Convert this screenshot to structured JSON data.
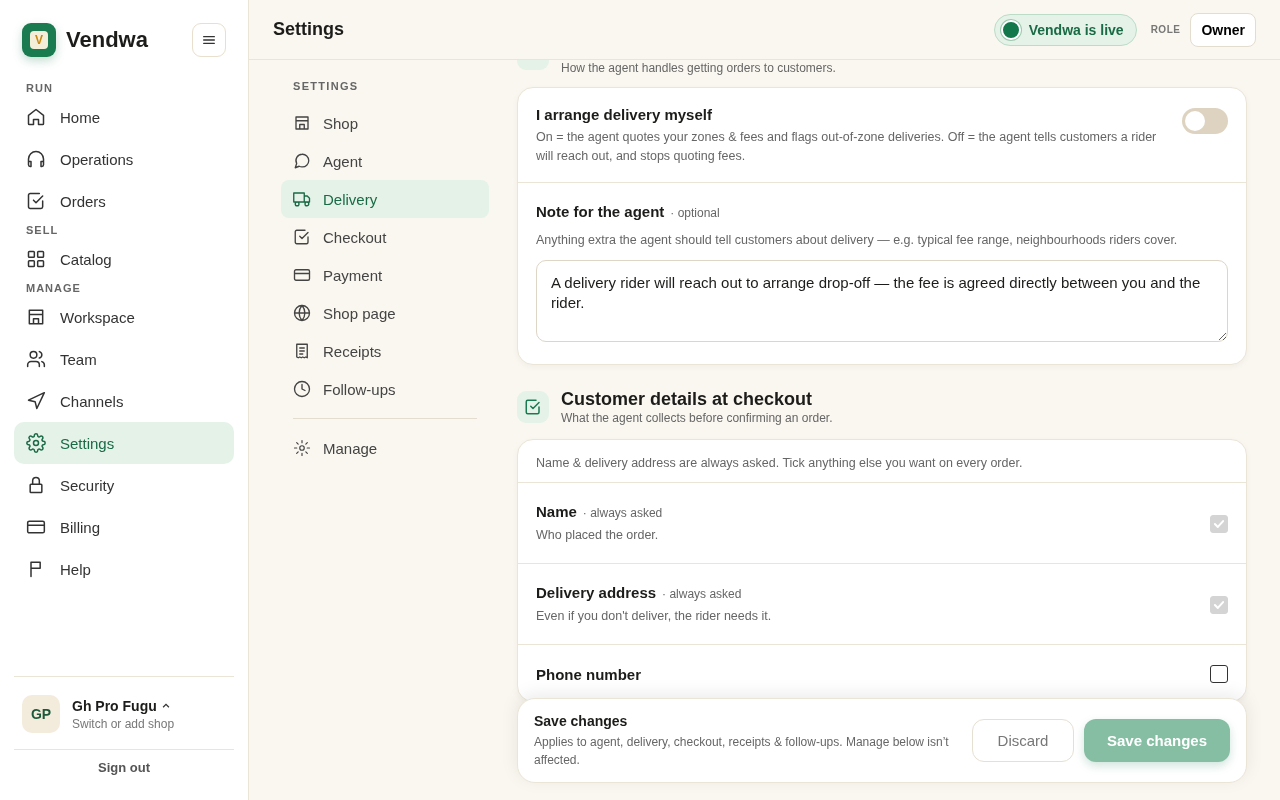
{
  "brand": {
    "name": "Vendwa",
    "mark": "V"
  },
  "nav": [
    {
      "heading": "RUN",
      "items": [
        {
          "label": "Home",
          "selected": false
        },
        {
          "label": "Operations",
          "selected": false
        },
        {
          "label": "Orders",
          "selected": false
        }
      ]
    },
    {
      "heading": "SELL",
      "items": [
        {
          "label": "Catalog",
          "selected": false
        }
      ]
    },
    {
      "heading": "MANAGE",
      "items": [
        {
          "label": "Workspace",
          "selected": false
        },
        {
          "label": "Team",
          "selected": false
        },
        {
          "label": "Channels",
          "selected": false
        },
        {
          "label": "Settings",
          "selected": true
        },
        {
          "label": "Security",
          "selected": false
        },
        {
          "label": "Billing",
          "selected": false
        },
        {
          "label": "Help",
          "selected": false
        }
      ]
    }
  ],
  "shop": {
    "initials": "GP",
    "name": "Gh Pro Fugu",
    "caption": "Switch or add shop"
  },
  "sign_out": "Sign out",
  "header": {
    "title": "Settings",
    "live": {
      "label": "Vendwa is live",
      "on": true
    },
    "role_label": "ROLE",
    "role": "Owner"
  },
  "settings_nav": {
    "heading": "SETTINGS",
    "items": [
      {
        "label": "Shop",
        "selected": false
      },
      {
        "label": "Agent",
        "selected": false
      },
      {
        "label": "Delivery",
        "selected": true
      },
      {
        "label": "Checkout",
        "selected": false
      },
      {
        "label": "Payment",
        "selected": false
      },
      {
        "label": "Shop page",
        "selected": false
      },
      {
        "label": "Receipts",
        "selected": false
      },
      {
        "label": "Follow-ups",
        "selected": false
      }
    ],
    "manage": "Manage"
  },
  "delivery": {
    "subtitle": "How the agent handles getting orders to customers.",
    "toggle": {
      "label": "I arrange delivery myself",
      "description": "On = the agent quotes your zones & fees and flags out-of-zone deliveries. Off = the agent tells customers a rider will reach out, and stops quoting fees.",
      "on": false
    },
    "note": {
      "label": "Note for the agent",
      "tag": "· optional",
      "description": "Anything extra the agent should tell customers about delivery — e.g. typical fee range, neighbourhoods riders cover.",
      "value": "A delivery rider will reach out to arrange drop-off — the fee is agreed directly between you and the rider."
    }
  },
  "checkout": {
    "title": "Customer details at checkout",
    "subtitle": "What the agent collects before confirming an order.",
    "intro": "Name & delivery address are always asked. Tick anything else you want on every order.",
    "fields": [
      {
        "label": "Name",
        "tag": "· always asked",
        "description": "Who placed the order.",
        "checked": true,
        "disabled": true
      },
      {
        "label": "Delivery address",
        "tag": "· always asked",
        "description": "Even if you don't deliver, the rider needs it.",
        "checked": true,
        "disabled": true
      },
      {
        "label": "Phone number",
        "checked": false,
        "disabled": false
      }
    ]
  },
  "save_bar": {
    "title": "Save changes",
    "description": "Applies to agent, delivery, checkout, receipts & follow-ups. Manage below isn’t affected.",
    "discard": "Discard",
    "save": "Save changes",
    "save_disabled": true
  }
}
